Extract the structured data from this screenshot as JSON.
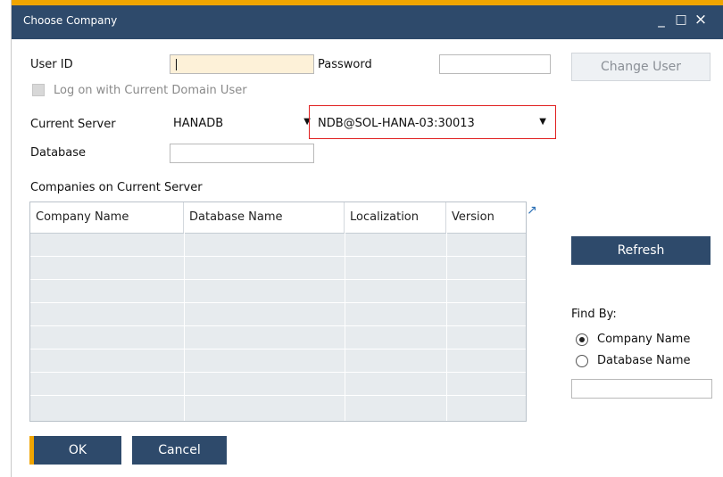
{
  "window": {
    "title": "Choose Company",
    "controls": {
      "minimize": "_",
      "maximize": "□",
      "close": "×"
    }
  },
  "form": {
    "user_id_label": "User ID",
    "user_id_value": "",
    "password_label": "Password",
    "password_value": "",
    "log_on_domain_label": "Log on with Current Domain User",
    "log_on_domain_checked": false,
    "current_server_label": "Current Server",
    "server_type": "HANADB",
    "server_name": "NDB@SOL-HANA-03:30013",
    "database_label": "Database",
    "database_value": ""
  },
  "buttons": {
    "change_user": "Change User",
    "refresh": "Refresh",
    "ok": "OK",
    "cancel": "Cancel"
  },
  "companies": {
    "section_label": "Companies on Current Server",
    "columns": [
      "Company Name",
      "Database Name",
      "Localization",
      "Version"
    ],
    "rows": [
      [],
      [],
      [],
      [],
      [],
      [],
      [],
      []
    ]
  },
  "find_by": {
    "label": "Find By:",
    "options": [
      "Company Name",
      "Database Name"
    ],
    "selected": "Company Name",
    "search_value": ""
  },
  "colors": {
    "title_bar": "#2e4a6b",
    "accent": "#f0a500",
    "highlight": "#e02020"
  }
}
